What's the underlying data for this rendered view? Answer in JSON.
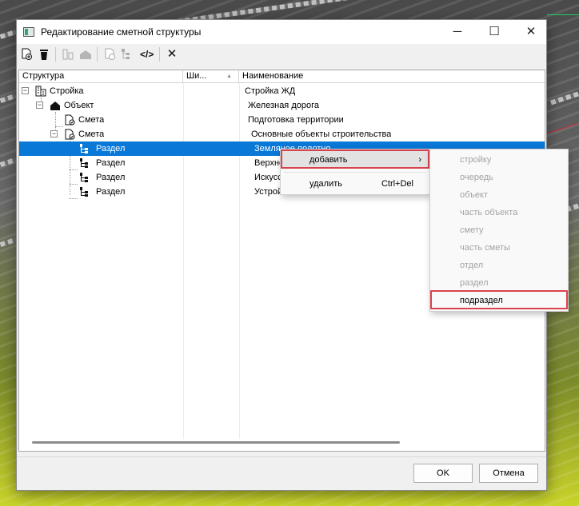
{
  "window": {
    "title": "Редактирование сметной структуры",
    "minimize": "─",
    "maximize": "☐",
    "close": "✕"
  },
  "toolbar": {
    "icons": [
      "add-document-icon",
      "delete-icon",
      "structure-icon",
      "house-icon",
      "document-check-icon",
      "hierarchy-icon",
      "code-icon",
      "close-icon"
    ]
  },
  "tree": {
    "columns": [
      "Структура",
      "Ши...",
      "Наименование"
    ],
    "rows": [
      {
        "structure": "Стройка",
        "name": "Стройка ЖД"
      },
      {
        "structure": "Объект",
        "name": "Железная дорога"
      },
      {
        "structure": "Смета",
        "name": "Подготовка территории"
      },
      {
        "structure": "Смета",
        "name": "Основные объекты строительства"
      },
      {
        "structure": "Раздел",
        "name": "Земляное полотно"
      },
      {
        "structure": "Раздел",
        "name": "Верхнее строение пути"
      },
      {
        "structure": "Раздел",
        "name": "Искусственные сооружения"
      },
      {
        "structure": "Раздел",
        "name": "Устройство переездов"
      }
    ]
  },
  "context_menu": {
    "add": "добавить",
    "delete": "удалить",
    "delete_shortcut": "Ctrl+Del",
    "submenu": [
      "стройку",
      "очередь",
      "объект",
      "часть объекта",
      "смету",
      "часть сметы",
      "отдел",
      "раздел",
      "подраздел"
    ]
  },
  "buttons": {
    "ok": "OK",
    "cancel": "Отмена"
  },
  "colors": {
    "selection": "#0a78d7",
    "highlight_box": "#d9434d"
  }
}
